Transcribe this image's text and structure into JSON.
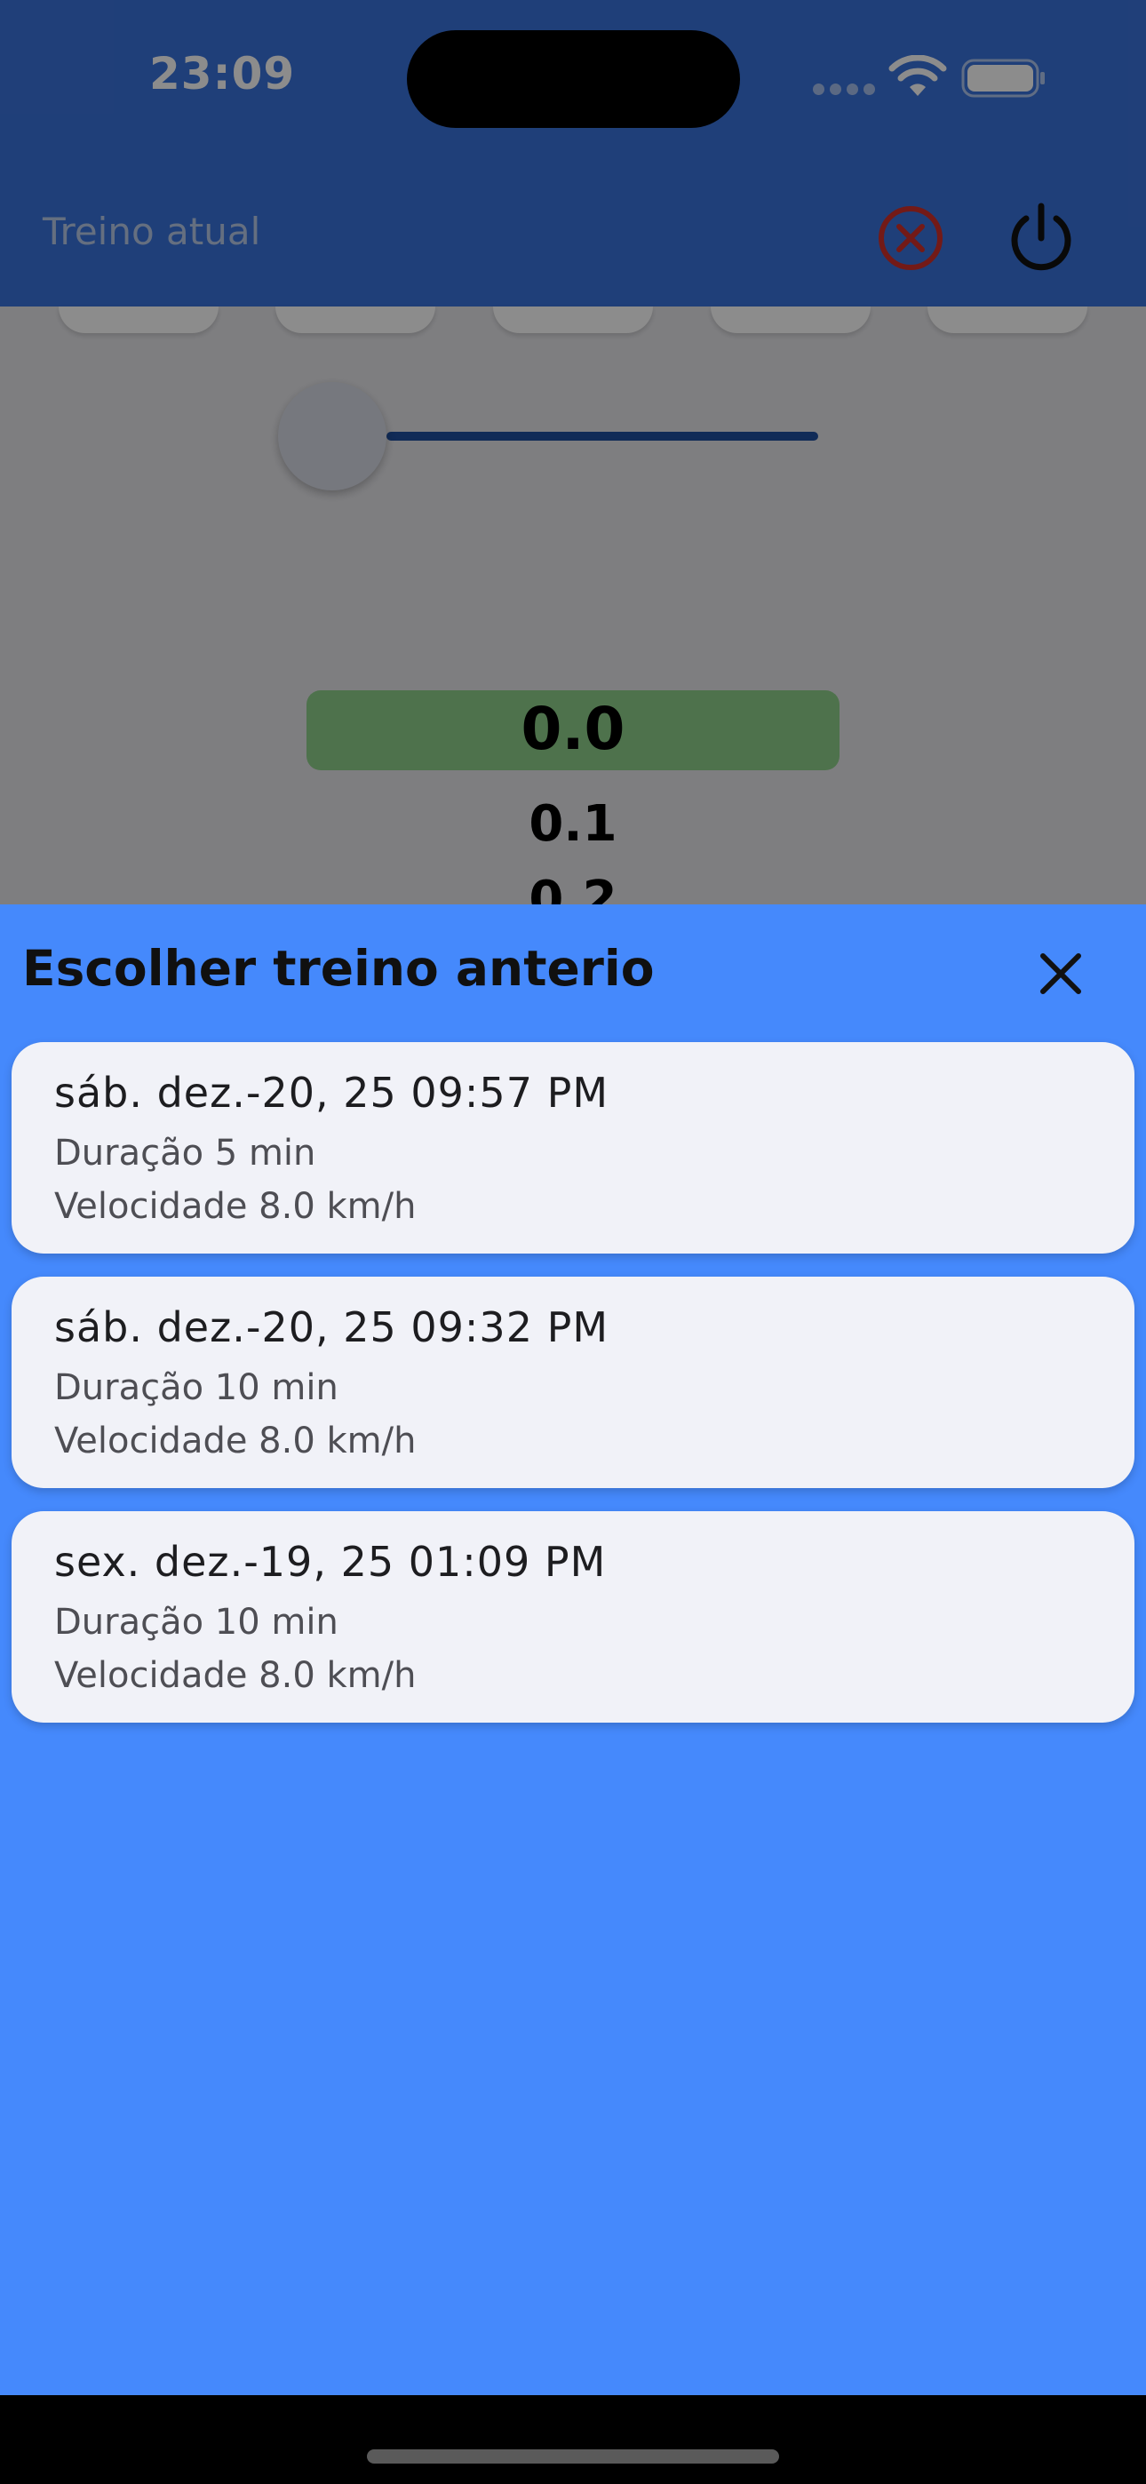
{
  "status_bar": {
    "time": "23:09"
  },
  "app_bar": {
    "title": "Treino atual",
    "cancel_icon": "cancel-circle-icon",
    "power_icon": "power-icon",
    "colors": {
      "background": "#3a73dc",
      "cancel": "#d2312b"
    }
  },
  "speed_picker": {
    "values": [
      "0.0",
      "0.1",
      "0.2"
    ],
    "selected": "0.0",
    "selected_color": "#8fd08a"
  },
  "sheet": {
    "title": "Escolher treino anterio",
    "close_icon": "close-icon",
    "background": "#4589fc",
    "workouts": [
      {
        "date": "sáb. dez.-20, 25 09:57 PM",
        "duration": "Duração 5 min",
        "speed": "Velocidade 8.0 km/h"
      },
      {
        "date": "sáb. dez.-20, 25 09:32 PM",
        "duration": "Duração 10 min",
        "speed": "Velocidade 8.0 km/h"
      },
      {
        "date": "sex. dez.-19, 25 01:09 PM",
        "duration": "Duração 10 min",
        "speed": "Velocidade 8.0 km/h"
      }
    ]
  }
}
